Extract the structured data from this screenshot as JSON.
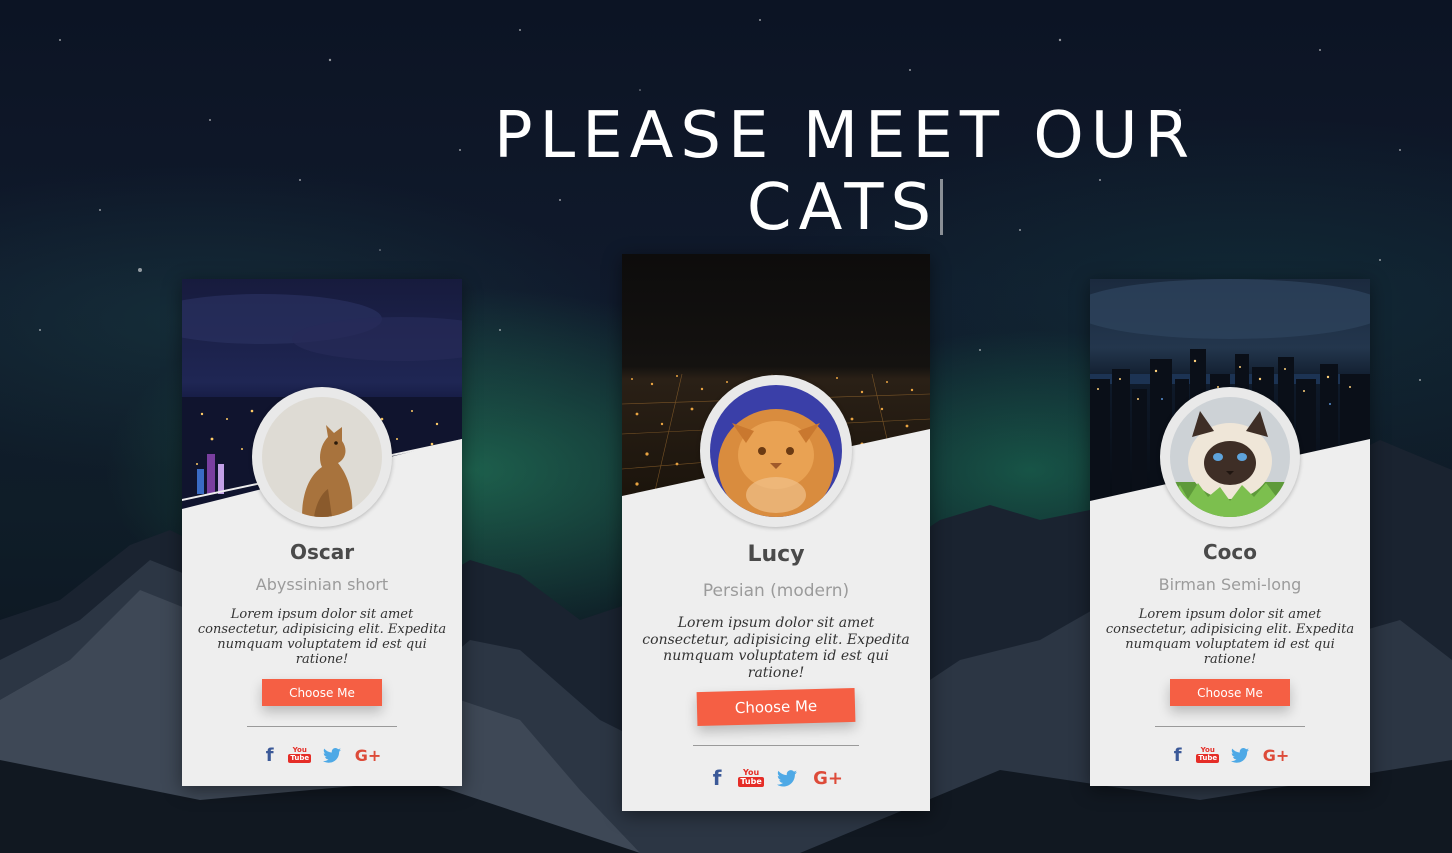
{
  "page": {
    "title_line1": "PLEASE MEET OUR",
    "title_line2": "CATS"
  },
  "cards": [
    {
      "name": "Oscar",
      "breed": "Abyssinian short",
      "description": "Lorem ipsum dolor sit amet consectetur, adipisicing elit. Expedita numquam voluptatem id est qui ratione!",
      "button_label": "Choose Me"
    },
    {
      "name": "Lucy",
      "breed": "Persian (modern)",
      "description": "Lorem ipsum dolor sit amet consectetur, adipisicing elit. Expedita numquam voluptatem id est qui ratione!",
      "button_label": "Choose Me"
    },
    {
      "name": "Coco",
      "breed": "Birman Semi-long",
      "description": "Lorem ipsum dolor sit amet consectetur, adipisicing elit. Expedita numquam voluptatem id est qui ratione!",
      "button_label": "Choose Me"
    }
  ],
  "social": {
    "facebook": "f",
    "youtube_top": "You",
    "youtube_bottom": "Tube",
    "twitter": "twitter-icon",
    "googleplus": "G+"
  },
  "colors": {
    "accent": "#f55f44",
    "card_bg": "#eeeeee",
    "facebook": "#3b5998",
    "youtube": "#e52d27",
    "twitter": "#4ea9e6",
    "googleplus": "#dd4b39"
  }
}
